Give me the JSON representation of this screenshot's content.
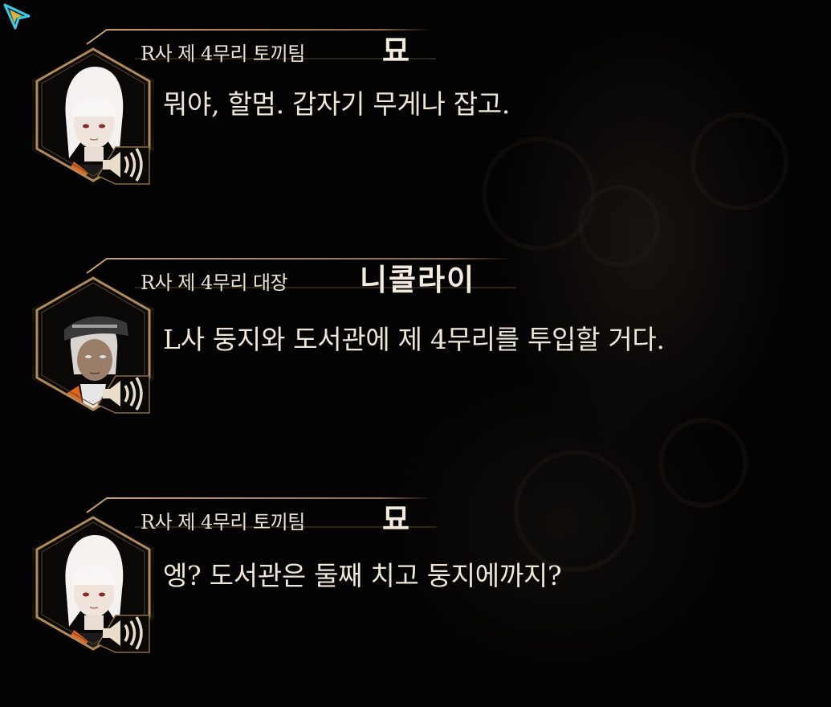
{
  "dialogue_log": [
    {
      "speaker_title": "R사 제 4무리 토끼팀",
      "speaker_name": "묘",
      "text": "뭐야, 할멈. 갑자기 무게나 잡고.",
      "portrait": "white-haired-girl-portrait",
      "voice_button": "speaker-sound-icon"
    },
    {
      "speaker_title": "R사 제 4무리 대장",
      "speaker_name": "니콜라이",
      "text": "L사 둥지와 도서관에 제 4무리를 투입할 거다.",
      "portrait": "capped-man-portrait",
      "voice_button": "speaker-sound-icon"
    },
    {
      "speaker_title": "R사 제 4무리 토끼팀",
      "speaker_name": "묘",
      "text": "엥? 도서관은 둘째 치고 둥지에까지?",
      "portrait": "white-haired-girl-portrait",
      "voice_button": "speaker-sound-icon"
    }
  ],
  "colors": {
    "background": "#050404",
    "frame_gold": "#b08a5a",
    "text": "#eee6d6",
    "cursor_cyan": "#3ec9e6",
    "accent_orange": "#e0641e"
  }
}
